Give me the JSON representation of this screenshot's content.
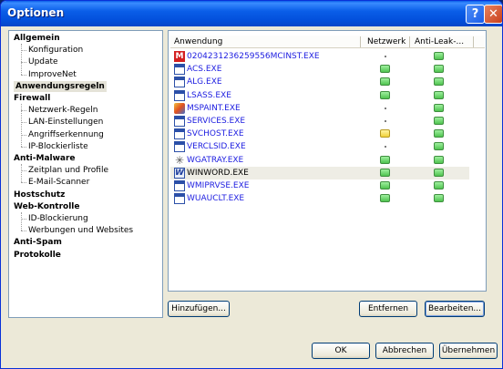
{
  "window": {
    "title": "Optionen",
    "help_glyph": "?",
    "close_glyph": "✕"
  },
  "tree": [
    {
      "label": "Allgemein",
      "level": 0
    },
    {
      "label": "Konfiguration",
      "level": 1
    },
    {
      "label": "Update",
      "level": 1
    },
    {
      "label": "ImproveNet",
      "level": 1
    },
    {
      "label": "Anwendungsregeln",
      "level": 0,
      "selected": true
    },
    {
      "label": "Firewall",
      "level": 0
    },
    {
      "label": "Netzwerk-Regeln",
      "level": 1
    },
    {
      "label": "LAN-Einstellungen",
      "level": 1
    },
    {
      "label": "Angriffserkennung",
      "level": 1
    },
    {
      "label": "IP-Blockierliste",
      "level": 1
    },
    {
      "label": "Anti-Malware",
      "level": 0
    },
    {
      "label": "Zeitplan und Profile",
      "level": 1
    },
    {
      "label": "E-Mail-Scanner",
      "level": 1
    },
    {
      "label": "Hostschutz",
      "level": 0
    },
    {
      "label": "Web-Kontrolle",
      "level": 0
    },
    {
      "label": "ID-Blockierung",
      "level": 1
    },
    {
      "label": "Werbungen und Websites",
      "level": 1
    },
    {
      "label": "Anti-Spam",
      "level": 0
    },
    {
      "label": "Protokolle",
      "level": 0
    }
  ],
  "list": {
    "columns": [
      "Anwendung",
      "Netzwerk",
      "Anti-Leak-..."
    ],
    "rows": [
      {
        "name": "0204231236259556MCINST.EXE",
        "icon": "mcafee-icon",
        "net": "dot",
        "leak": "green"
      },
      {
        "name": "ACS.EXE",
        "icon": "app-window-icon",
        "net": "green",
        "leak": "green"
      },
      {
        "name": "ALG.EXE",
        "icon": "app-window-icon",
        "net": "green",
        "leak": "green"
      },
      {
        "name": "LSASS.EXE",
        "icon": "app-window-icon",
        "net": "green",
        "leak": "green"
      },
      {
        "name": "MSPAINT.EXE",
        "icon": "paint-icon",
        "net": "dot",
        "leak": "green"
      },
      {
        "name": "SERVICES.EXE",
        "icon": "app-window-icon",
        "net": "dot",
        "leak": "green"
      },
      {
        "name": "SVCHOST.EXE",
        "icon": "app-window-icon",
        "net": "yellow",
        "leak": "green"
      },
      {
        "name": "VERCLSID.EXE",
        "icon": "app-window-icon",
        "net": "dot",
        "leak": "green"
      },
      {
        "name": "WGATRAY.EXE",
        "icon": "star-icon",
        "net": "green",
        "leak": "green"
      },
      {
        "name": "WINWORD.EXE",
        "icon": "word-icon",
        "net": "green",
        "leak": "green",
        "highlighted": true
      },
      {
        "name": "WMIPRVSE.EXE",
        "icon": "app-window-icon",
        "net": "green",
        "leak": "green"
      },
      {
        "name": "WUAUCLT.EXE",
        "icon": "app-window-icon",
        "net": "green",
        "leak": "green"
      }
    ]
  },
  "buttons": {
    "add": "Hinzufügen...",
    "remove": "Entfernen",
    "edit": "Bearbeiten...",
    "ok": "OK",
    "cancel": "Abbrechen",
    "apply": "Übernehmen"
  }
}
